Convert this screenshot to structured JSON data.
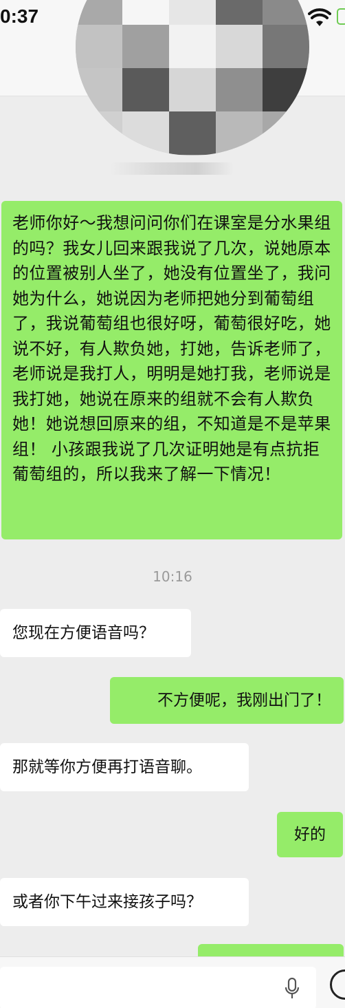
{
  "status_bar": {
    "time": "0:37",
    "wifi_icon": "wifi-icon",
    "battery_icon": "battery-icon",
    "battery_color": "#6ecb52"
  },
  "contact": {
    "avatar_icon": "blurred-avatar",
    "mosaic_colors": [
      "#b4b4b4",
      "#8c8c8c",
      "#d4d4d4",
      "#333333",
      "#c8c8c8",
      "#a9a9a9",
      "#f6f6f6",
      "#e6e6e6",
      "#6a6a6a",
      "#8a8a8a",
      "#c2c2c2",
      "#a0a0a0",
      "#f2f2f2",
      "#d8d8d8",
      "#777777",
      "#c5c5c5",
      "#5a5a5a",
      "#d6d6d6",
      "#8f8f8f",
      "#3e3e3e",
      "#d0d0d0",
      "#dcdcdc",
      "#5f5f5f",
      "#b9b9b9",
      "#a8a8a8"
    ]
  },
  "chat": {
    "messages": [
      {
        "from": "me",
        "text": "老师你好～我想问问你们在课室是分水果组的吗？我女儿回来跟我说了几次，说她原本的位置被别人坐了，她没有位置坐了，我问她为什么，她说因为老师把她分到葡萄组了，我说葡萄组也很好呀，葡萄很好吃，她说不好，有人欺负她，打她，告诉老师了，老师说是我打人，明明是她打我，老师说是我打她，她说在原来的组就不会有人欺负她！她说想回原来的组，不知道是不是苹果组！ 小孩跟我说了几次证明她是有点抗拒葡萄组的，所以我来了解一下情况！"
      },
      {
        "from": "them",
        "text": "您现在方便语音吗？"
      },
      {
        "from": "me",
        "text": "不方便呢，我刚出门了！"
      },
      {
        "from": "them",
        "text": "那就等你方便再打语音聊。"
      },
      {
        "from": "me",
        "text": "好的"
      },
      {
        "from": "them",
        "text": "或者你下午过来接孩子吗？"
      },
      {
        "from": "me",
        "text": ""
      }
    ],
    "timestamp": "10:16",
    "outgoing_color": "#95ec69",
    "incoming_color": "#ffffff"
  },
  "input_bar": {
    "mic_icon": "microphone-icon",
    "emoji_icon": "emoji-icon"
  }
}
